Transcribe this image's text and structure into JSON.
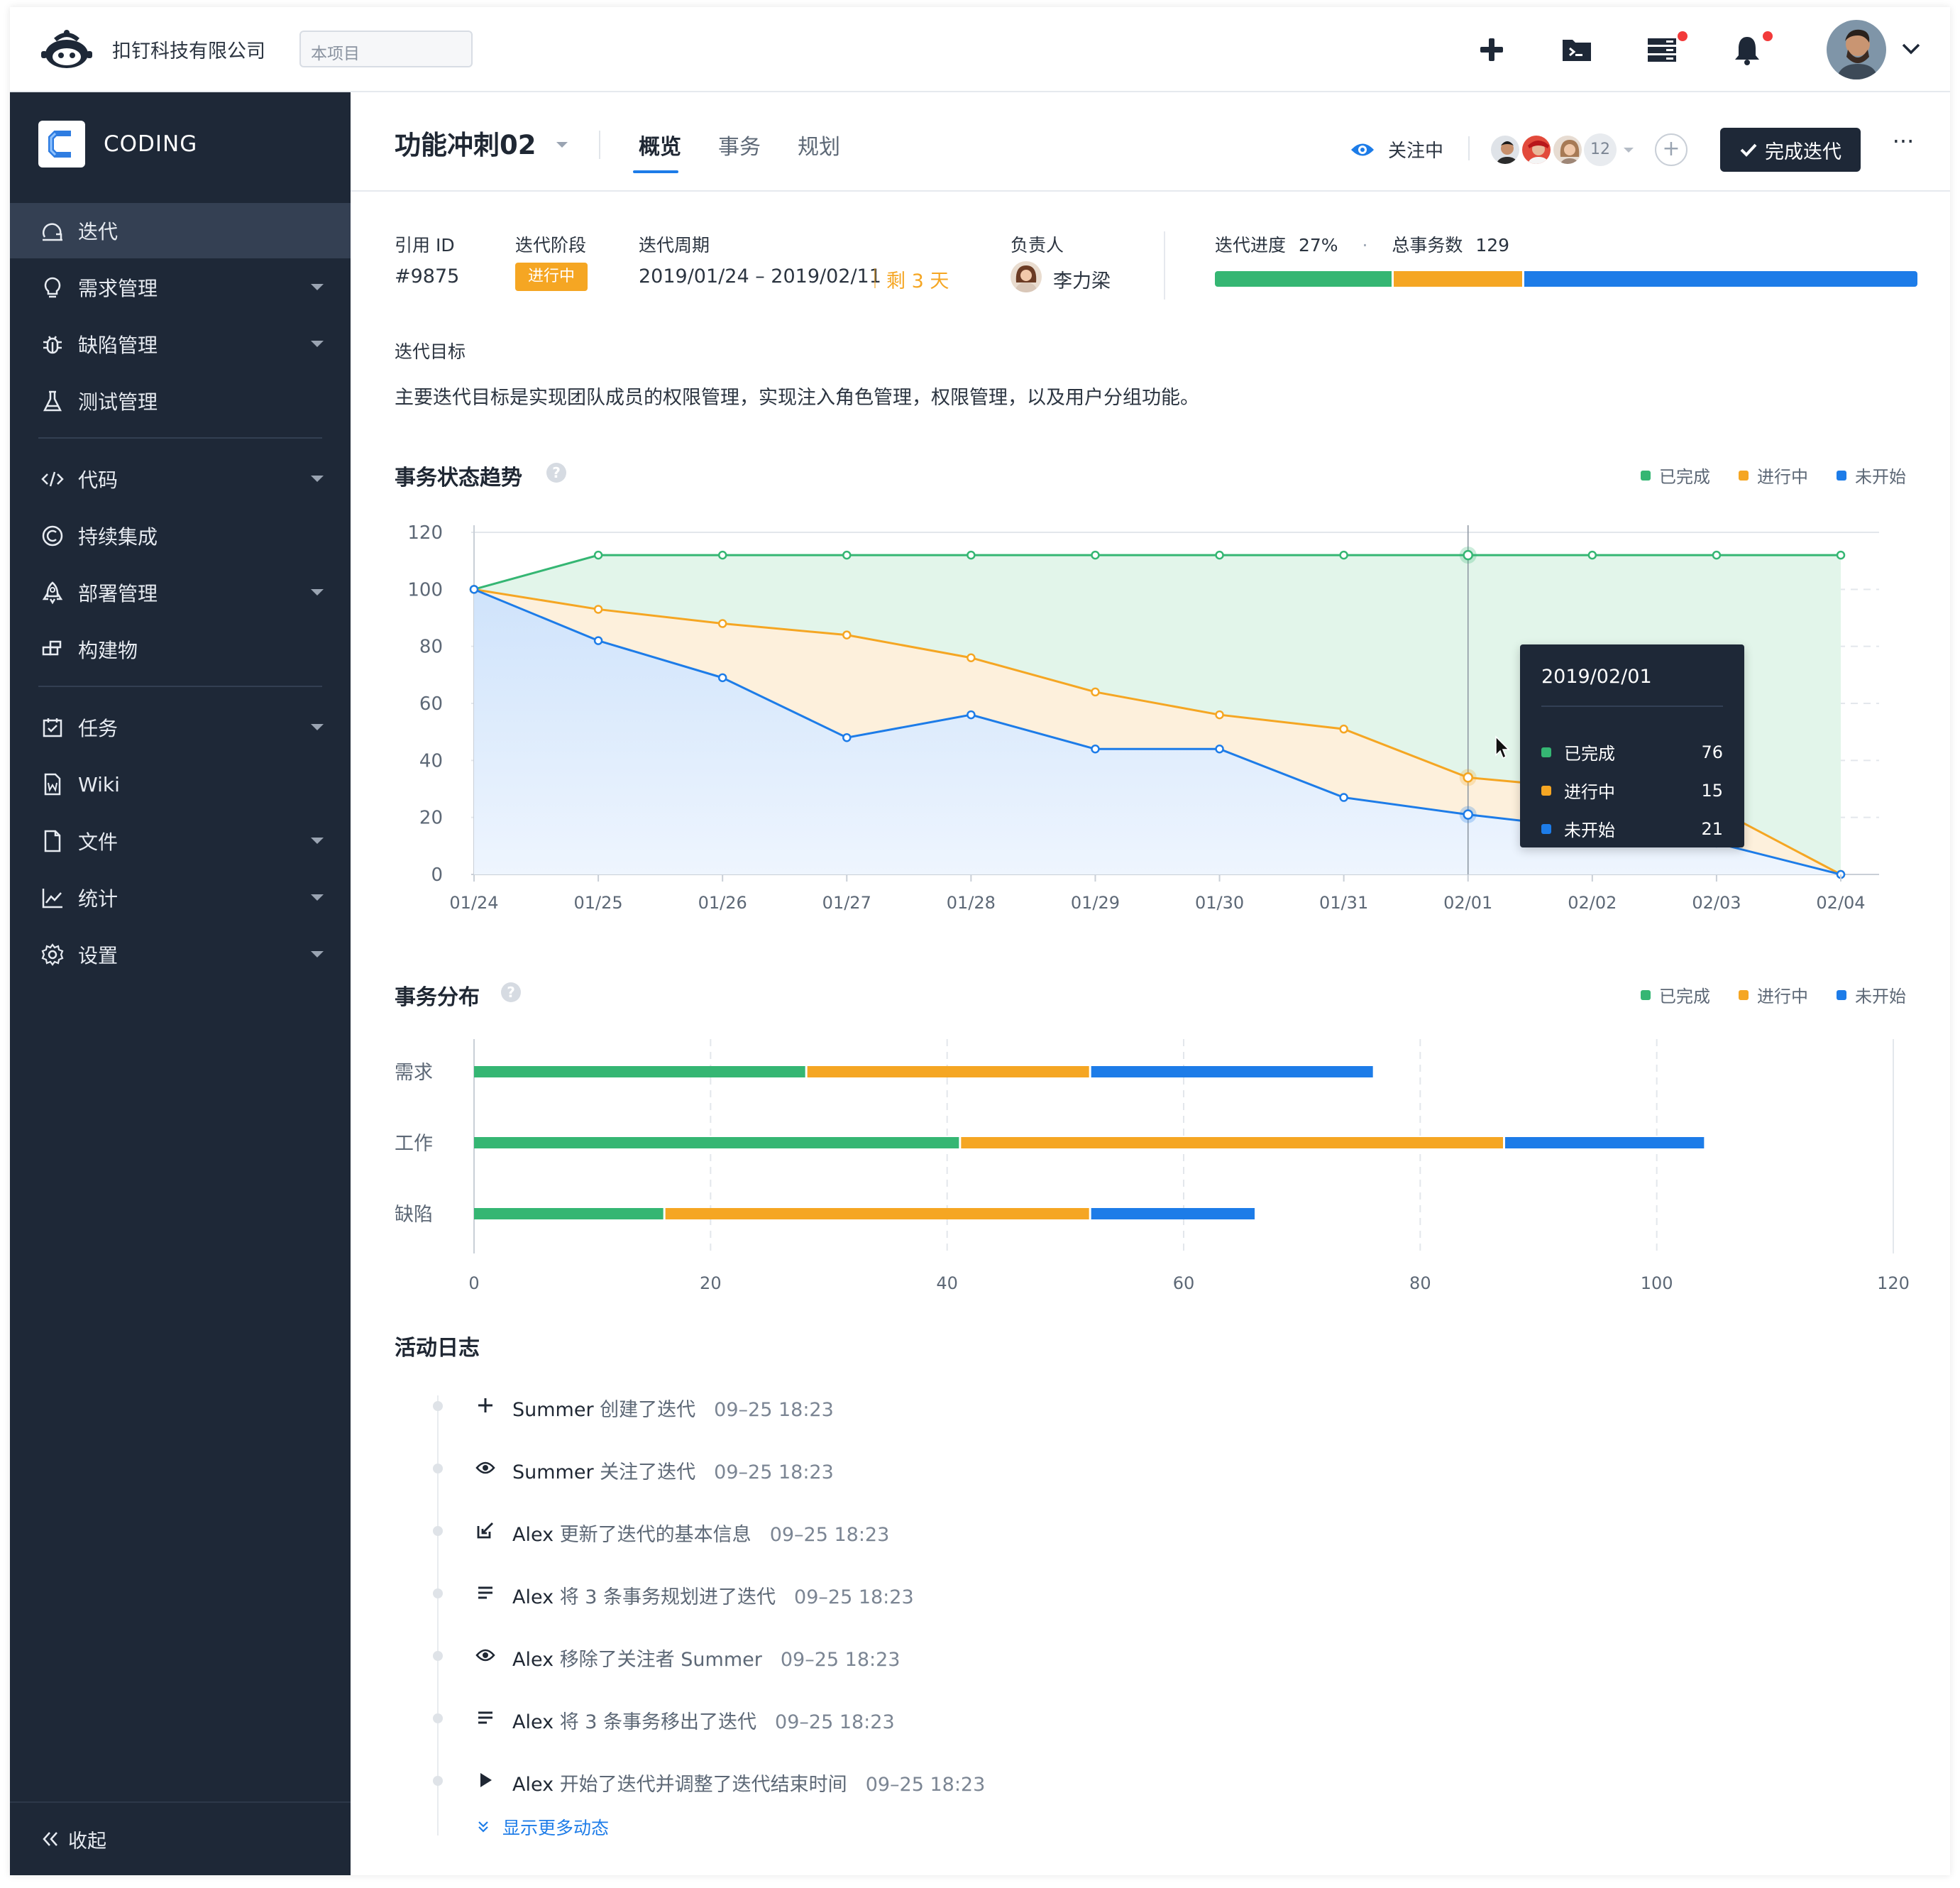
{
  "header": {
    "company": "扣钉科技有限公司",
    "scope_placeholder": "本项目"
  },
  "sidebar": {
    "brand": "CODING",
    "items": [
      {
        "label": "迭代",
        "icon": "iteration-icon",
        "active": true,
        "caret": false
      },
      {
        "label": "需求管理",
        "icon": "lightbulb-icon",
        "caret": true
      },
      {
        "label": "缺陷管理",
        "icon": "bug-icon",
        "caret": true
      },
      {
        "label": "测试管理",
        "icon": "flask-icon",
        "caret": false
      },
      {
        "label": "代码",
        "icon": "code-icon",
        "caret": true
      },
      {
        "label": "持续集成",
        "icon": "ci-icon",
        "caret": false
      },
      {
        "label": "部署管理",
        "icon": "rocket-icon",
        "caret": true
      },
      {
        "label": "构建物",
        "icon": "artifact-icon",
        "caret": false
      },
      {
        "label": "任务",
        "icon": "task-icon",
        "caret": true
      },
      {
        "label": "Wiki",
        "icon": "wiki-icon",
        "caret": false
      },
      {
        "label": "文件",
        "icon": "file-icon",
        "caret": true
      },
      {
        "label": "统计",
        "icon": "stats-icon",
        "caret": true
      },
      {
        "label": "设置",
        "icon": "gear-icon",
        "caret": true
      }
    ],
    "collapse_label": "收起"
  },
  "subheader": {
    "title": "功能冲刺02",
    "tabs": [
      "概览",
      "事务",
      "规划"
    ],
    "follow_label": "关注中",
    "member_count": "12",
    "finish_label": "完成迭代",
    "more_label": "···"
  },
  "info": {
    "ref_id_label": "引用 ID",
    "ref_id": "#9875",
    "stage_label": "迭代阶段",
    "stage": "进行中",
    "period_label": "迭代周期",
    "period": "2019/01/24 – 2019/02/11",
    "remaining": "剩 3 天",
    "owner_label": "负责人",
    "owner": "李力梁",
    "progress_label": "迭代进度",
    "progress_value": "27%",
    "total_label": "总事务数",
    "total_value": "129",
    "progress_segments": [
      {
        "fraction": 0.252,
        "color": "#35b673"
      },
      {
        "fraction": 0.185,
        "color": "#f5a623"
      },
      {
        "fraction": 0.563,
        "color": "#1d7ce8"
      }
    ],
    "goal_label": "迭代目标",
    "goal_text": "主要迭代目标是实现团队成员的权限管理，实现注入角色管理，权限管理，以及用户分组功能。"
  },
  "colors": {
    "done": "#35b673",
    "doing": "#f5a623",
    "todo": "#1d7ce8"
  },
  "legend": {
    "done": "已完成",
    "doing": "进行中",
    "todo": "未开始"
  },
  "trend": {
    "title": "事务状态趋势",
    "tooltip": {
      "date": "2019/02/01",
      "rows": [
        {
          "label": "已完成",
          "value": "76"
        },
        {
          "label": "进行中",
          "value": "15"
        },
        {
          "label": "未开始",
          "value": "21"
        }
      ]
    }
  },
  "distribution": {
    "title": "事务分布"
  },
  "chart_data": [
    {
      "type": "area",
      "title": "事务状态趋势",
      "x": [
        "01/24",
        "01/25",
        "01/26",
        "01/27",
        "01/28",
        "01/29",
        "01/30",
        "01/31",
        "02/01",
        "02/02",
        "02/03",
        "02/04"
      ],
      "ylim": [
        0,
        120
      ],
      "yticks": [
        0,
        20,
        40,
        60,
        80,
        100,
        120
      ],
      "grid": true,
      "legend": "top-right",
      "series": [
        {
          "name": "已完成",
          "values": [
            100,
            112,
            112,
            112,
            112,
            112,
            112,
            112,
            112,
            112,
            112,
            112
          ]
        },
        {
          "name": "进行中",
          "values": [
            100,
            93,
            88,
            84,
            76,
            64,
            56,
            51,
            34,
            30,
            23,
            0
          ]
        },
        {
          "name": "未开始",
          "values": [
            100,
            82,
            69,
            48,
            56,
            44,
            44,
            27,
            21,
            16,
            11,
            0
          ]
        }
      ]
    },
    {
      "type": "bar",
      "orientation": "horizontal",
      "stacked": true,
      "title": "事务分布",
      "categories": [
        "需求",
        "工作",
        "缺陷"
      ],
      "xlim": [
        0,
        120
      ],
      "xticks": [
        0,
        20,
        40,
        60,
        80,
        100,
        120
      ],
      "legend": "top-right",
      "series": [
        {
          "name": "已完成",
          "values": [
            28,
            41,
            16
          ]
        },
        {
          "name": "进行中",
          "values": [
            24,
            46,
            36
          ]
        },
        {
          "name": "未开始",
          "values": [
            24,
            17,
            14
          ]
        }
      ]
    }
  ],
  "activity": {
    "title": "活动日志",
    "items": [
      {
        "icon": "plus-icon",
        "who": "Summer",
        "action": "创建了迭代",
        "time": "09–25 18:23"
      },
      {
        "icon": "eye-icon",
        "who": "Summer",
        "action": "关注了迭代",
        "time": "09–25 18:23"
      },
      {
        "icon": "edit-icon",
        "who": "Alex",
        "action": "更新了迭代的基本信息",
        "time": "09–25 18:23"
      },
      {
        "icon": "list-icon",
        "who": "Alex",
        "action": "将 3 条事务规划进了迭代",
        "time": "09–25 18:23"
      },
      {
        "icon": "eye-icon",
        "who": "Alex",
        "action": "移除了关注者 Summer",
        "time": "09–25 18:23"
      },
      {
        "icon": "list-icon",
        "who": "Alex",
        "action": "将 3 条事务移出了迭代",
        "time": "09–25 18:23"
      },
      {
        "icon": "play-icon",
        "who": "Alex",
        "action": "开始了迭代并调整了迭代结束时间",
        "time": "09–25 18:23"
      }
    ],
    "show_more": "显示更多动态"
  }
}
